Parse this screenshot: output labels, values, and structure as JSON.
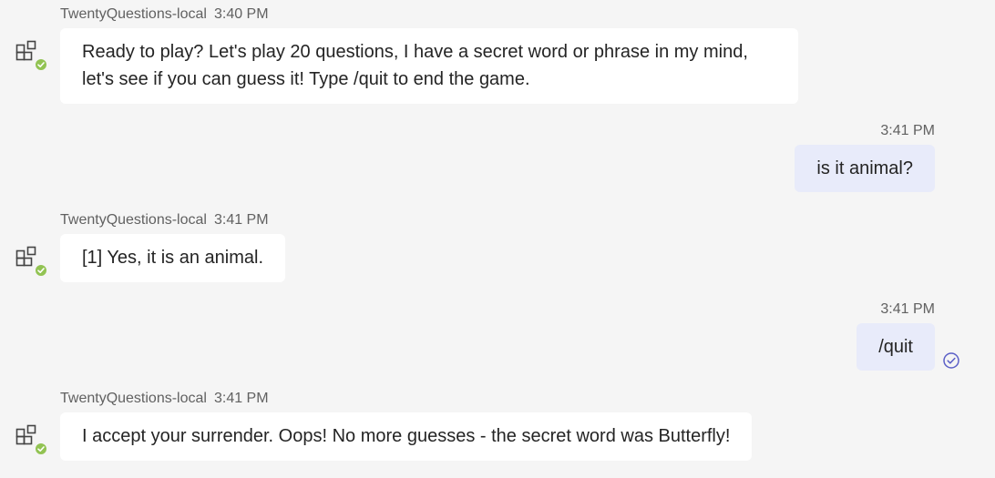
{
  "colors": {
    "background": "#f5f5f5",
    "bot_bubble": "#ffffff",
    "user_bubble": "#e8ebfa",
    "presence_available": "#92c353",
    "accent": "#5b5fc7"
  },
  "messages": [
    {
      "from": "bot",
      "sender": "TwentyQuestions-local",
      "time": "3:40 PM",
      "text": "Ready to play? Let's play 20 questions, I have a secret word or phrase in my mind, let's see if you can guess it! Type /quit to end the game.",
      "avatar_icon": "bot-app-icon",
      "presence": "available"
    },
    {
      "from": "user",
      "time": "3:41 PM",
      "text": "is it animal?"
    },
    {
      "from": "bot",
      "sender": "TwentyQuestions-local",
      "time": "3:41 PM",
      "text": "[1] Yes, it is an animal.",
      "avatar_icon": "bot-app-icon",
      "presence": "available"
    },
    {
      "from": "user",
      "time": "3:41 PM",
      "text": "/quit",
      "status_icon": "read-receipt-icon"
    },
    {
      "from": "bot",
      "sender": "TwentyQuestions-local",
      "time": "3:41 PM",
      "text": "I accept your surrender. Oops! No more guesses - the secret word was Butterfly!",
      "avatar_icon": "bot-app-icon",
      "presence": "available"
    }
  ]
}
